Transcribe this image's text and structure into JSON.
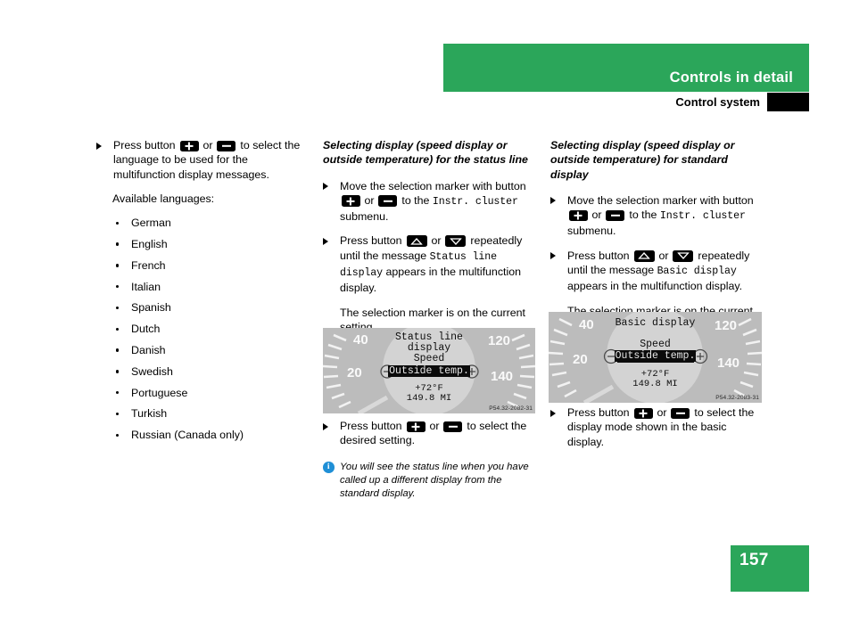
{
  "header": {
    "title": "Controls in detail",
    "subtitle": "Control system",
    "green": "#2ba65a"
  },
  "footer": {
    "page_number": "157"
  },
  "column1": {
    "step1": {
      "lead": "Press button",
      "or": "or",
      "tail": "to select the language to be used for the multifunction display messages."
    },
    "available_label": "Available languages:",
    "languages": [
      "German",
      "English",
      "French",
      "Italian",
      "Spanish",
      "Dutch",
      "Danish",
      "Swedish",
      "Portuguese",
      "Turkish",
      "Russian (Canada only)"
    ]
  },
  "column2": {
    "title": "Selecting display (speed display or outside temperature) for the status line",
    "step1": {
      "lead": "Move the selection marker with button",
      "or": "or",
      "mid": "to the",
      "mono": "Instr. cluster",
      "tail": "submenu."
    },
    "step2": {
      "lead": "Press button",
      "or": "or",
      "mid": "repeatedly until the message",
      "mono": "Status line display",
      "tail": "appears in the multifunction display."
    },
    "note_marker": "The selection marker is on the current setting.",
    "step3": {
      "lead": "Press button",
      "or": "or",
      "tail": "to select the desired setting."
    },
    "info_note": "You will see the status line when you have called up a different display from the standard display.",
    "info_icon": "info-icon",
    "figure": {
      "code": "P54.32-2082-31",
      "line1": "Status line",
      "line2": "display",
      "line3": "Speed",
      "highlight": "Outside temp.",
      "temp": "+72°F",
      "odo": "149.8 MI",
      "ticks": [
        "40",
        "20",
        "120",
        "140"
      ],
      "minus_sym": "−",
      "plus_sym": "+"
    }
  },
  "column3": {
    "title": "Selecting display (speed display or outside temperature) for standard display",
    "step1": {
      "lead": "Move the selection marker with button",
      "or": "or",
      "mid": "to the",
      "mono": "Instr. cluster",
      "tail": "submenu."
    },
    "step2": {
      "lead": "Press button",
      "or": "or",
      "mid": "repeatedly until the message",
      "mono": "Basic display",
      "tail": "appears in the multifunction display."
    },
    "note_marker": "The selection marker is on the current setting.",
    "step3": {
      "lead": "Press button",
      "or": "or",
      "tail": "to select the display mode shown in the basic display."
    },
    "figure": {
      "code": "P54.32-2083-31",
      "line1": "Basic display",
      "line3": "Speed",
      "highlight": "Outside temp.",
      "temp": "+72°F",
      "odo": "149.8 MI",
      "ticks": [
        "40",
        "20",
        "120",
        "140"
      ],
      "minus_sym": "−",
      "plus_sym": "+"
    }
  }
}
